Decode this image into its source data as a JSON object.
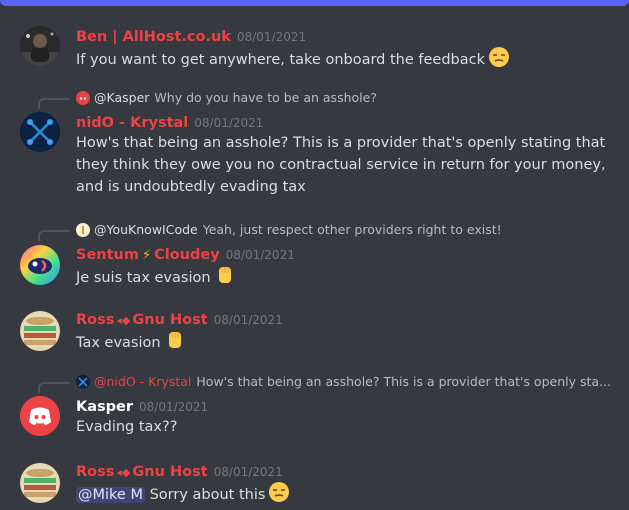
{
  "messages": [
    {
      "author": "Ben | AllHost.co.uk",
      "time": "08/01/2021",
      "text": "If you want to get anywhere, take onboard the feedback",
      "emoji": "smirk-emoji"
    },
    {
      "reply": {
        "author": "@Kasper",
        "text": "Why do you have to be an asshole?"
      },
      "author": "nidO - Krystal",
      "time": "08/01/2021",
      "lines": [
        "How's that being an asshole? This is a provider that's openly stating that",
        "they think they owe you no contractual service in return for your money,",
        "and is undoubtedly evading tax"
      ]
    },
    {
      "reply": {
        "author": "@YouKnowICode",
        "text": "Yeah, just respect other providers right to exist!"
      },
      "author_a": "Sentum",
      "author_b": "Cloudey",
      "time": "08/01/2021",
      "text": "Je suis tax evasion",
      "emoji": "raised-fist-emoji"
    },
    {
      "author_a": "Ross",
      "author_b": "Gnu Host",
      "time": "08/01/2021",
      "text": "Tax evasion",
      "emoji": "raised-fist-emoji"
    },
    {
      "reply": {
        "author": "@nidO - Krystal",
        "text": "How's that being an asshole? This is a provider that's openly sta..."
      },
      "author": "Kasper",
      "time": "08/01/2021",
      "text": "Evading tax??"
    },
    {
      "author_a": "Ross",
      "author_b": "Gnu Host",
      "time": "08/01/2021",
      "mention": "@Mike M",
      "text": "Sorry about this",
      "emoji": "smirk-emoji"
    }
  ],
  "colors": {
    "background": "#36393f",
    "username_red": "#ed4245",
    "mention_bg": "#5865f2",
    "discord_red_avatar": "#ed4245"
  }
}
